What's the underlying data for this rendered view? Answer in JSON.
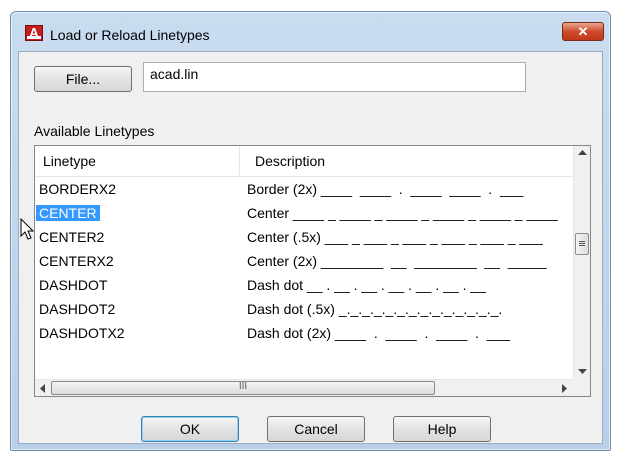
{
  "window": {
    "title": "Load or Reload Linetypes",
    "close_glyph": "✕",
    "icon_letter": "A"
  },
  "file": {
    "button_label": "File...",
    "value": "acad.lin"
  },
  "list": {
    "section_label": "Available Linetypes",
    "columns": [
      "Linetype",
      "Description"
    ],
    "rows": [
      {
        "name": "BORDERX2",
        "desc": "Border (2x) ____  ____  .  ____  ____  .  ___"
      },
      {
        "name": "CENTER",
        "desc": "Center ____ _ ____ _ ____ _ ____ _ ____ _ ____",
        "selected": true
      },
      {
        "name": "CENTER2",
        "desc": "Center (.5x) ___ _ ___ _ ___ _ ___ _ ___ _ ___"
      },
      {
        "name": "CENTERX2",
        "desc": "Center (2x) ________  __  ________  __  _____"
      },
      {
        "name": "DASHDOT",
        "desc": "Dash dot __ . __ . __ . __ . __ . __ . __"
      },
      {
        "name": "DASHDOT2",
        "desc": "Dash dot (.5x) _._._._._._._._._._._._._._."
      },
      {
        "name": "DASHDOTX2",
        "desc": "Dash dot (2x) ____  .  ____  .  ____  .  ___"
      }
    ],
    "hscroll_thumb_glyph": "III"
  },
  "buttons": {
    "ok": "OK",
    "cancel": "Cancel",
    "help": "Help"
  },
  "colors": {
    "selection": "#3399ff",
    "close_button": "#cf4b2b",
    "title_gradient": "#c9dcf0"
  }
}
